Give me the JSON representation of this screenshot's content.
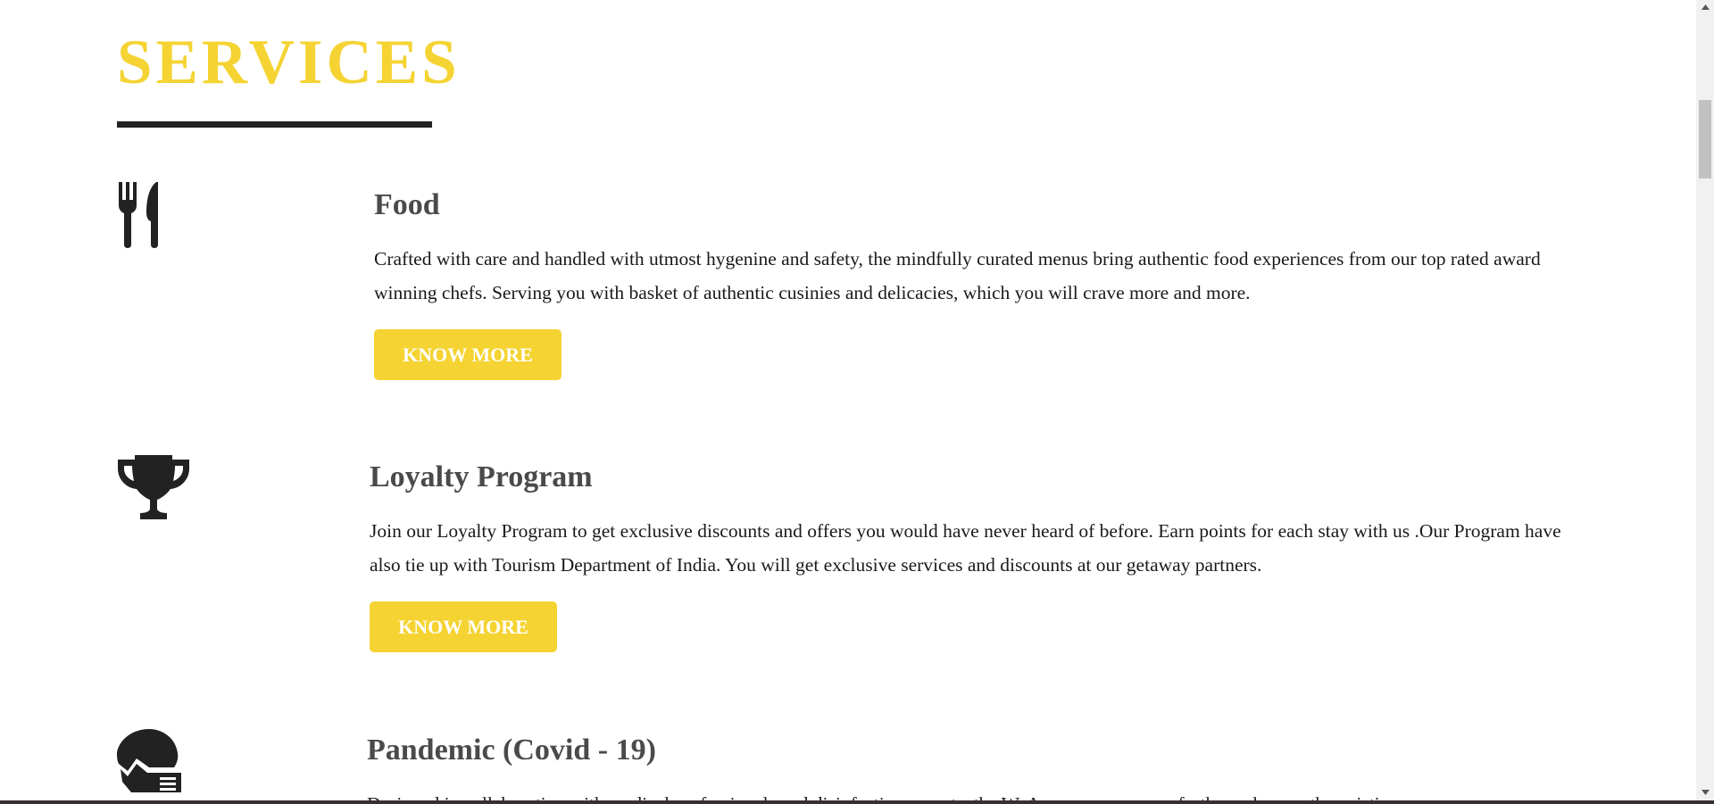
{
  "section": {
    "heading": "SERVICES"
  },
  "services": [
    {
      "title": "Food",
      "icon": "fork-knife-icon",
      "description": "Crafted with care and handled with utmost hygenine and safety, the mindfully curated menus bring authentic food experiences from our top rated award winning chefs. Serving you with basket of authentic cusinies and delicacies, which you will crave more and more.",
      "button_label": "KNOW MORE"
    },
    {
      "title": "Loyalty Program",
      "icon": "trophy-icon",
      "description": "Join our Loyalty Program to get exclusive discounts and offers you would have never heard of before. Earn points for each stay with us .Our Program have also tie up with Tourism Department of India. You will get exclusive services and discounts at our getaway partners.",
      "button_label": "KNOW MORE"
    },
    {
      "title": "Pandemic (Covid - 19)",
      "icon": "masked-head-icon",
      "description": "Designed in collaboration with medical professionals and disinfection experts, the WeAssure programme further enhances the existing"
    }
  ],
  "colors": {
    "accent": "#f5d332",
    "heading_rule": "#222222",
    "icon": "#222222",
    "title": "#4a4a4a",
    "body_text": "#1a1a1a"
  }
}
